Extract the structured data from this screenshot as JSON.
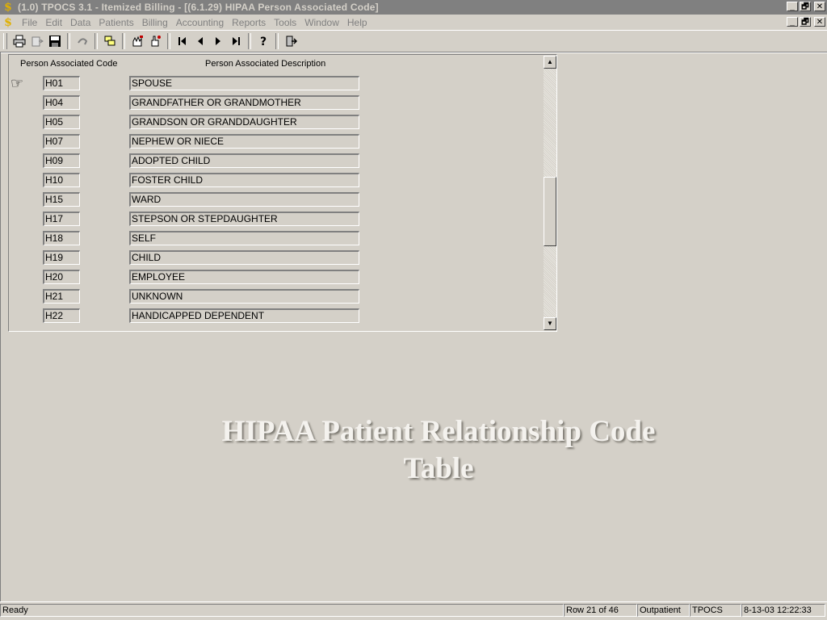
{
  "window": {
    "title": "(1.0) TPOCS 3.1 - Itemized Billing - [(6.1.29) HIPAA Person Associated Code]",
    "app_icon": "$",
    "minimize": "_",
    "restore": "🗗",
    "close": "✕"
  },
  "menu": {
    "items": [
      "File",
      "Edit",
      "Data",
      "Patients",
      "Billing",
      "Accounting",
      "Reports",
      "Tools",
      "Window",
      "Help"
    ]
  },
  "toolbar": {
    "icons": [
      "print-icon",
      "print-preview-icon",
      "save-icon",
      "undo-icon",
      "copy-records-icon",
      "hand-edit-icon",
      "hand-point-icon",
      "first-record-icon",
      "previous-record-icon",
      "next-record-icon",
      "last-record-icon",
      "help-icon",
      "exit-icon"
    ]
  },
  "grid": {
    "col_code_header": "Person Associated Code",
    "col_desc_header": "Person Associated Description",
    "rows": [
      {
        "code": "H01",
        "description": "SPOUSE"
      },
      {
        "code": "H04",
        "description": "GRANDFATHER OR GRANDMOTHER"
      },
      {
        "code": "H05",
        "description": "GRANDSON OR GRANDDAUGHTER"
      },
      {
        "code": "H07",
        "description": "NEPHEW OR NIECE"
      },
      {
        "code": "H09",
        "description": "ADOPTED CHILD"
      },
      {
        "code": "H10",
        "description": "FOSTER CHILD"
      },
      {
        "code": "H15",
        "description": "WARD"
      },
      {
        "code": "H17",
        "description": "STEPSON OR STEPDAUGHTER"
      },
      {
        "code": "H18",
        "description": "SELF"
      },
      {
        "code": "H19",
        "description": "CHILD"
      },
      {
        "code": "H20",
        "description": "EMPLOYEE"
      },
      {
        "code": "H21",
        "description": "UNKNOWN"
      },
      {
        "code": "H22",
        "description": "HANDICAPPED DEPENDENT"
      }
    ]
  },
  "caption": {
    "line1": "HIPAA Patient Relationship Code",
    "line2": "Table"
  },
  "status": {
    "state": "Ready",
    "row": "Row 21 of 46",
    "mode": "Outpatient",
    "app": "TPOCS",
    "datetime": "8-13-03 12:22:33"
  }
}
